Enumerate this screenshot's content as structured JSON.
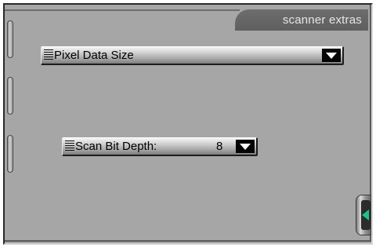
{
  "panel": {
    "title": "scanner extras"
  },
  "side_tabs": [
    {
      "name": "side-tab-1"
    },
    {
      "name": "side-tab-2"
    },
    {
      "name": "side-tab-3"
    }
  ],
  "pixel_data_size": {
    "label": "Pixel Data Size",
    "icon": "grip-lines-icon",
    "arrow_icon": "triangle-down-icon"
  },
  "scan_bit_depth": {
    "label": "Scan Bit Depth:",
    "value": "8",
    "icon": "grip-lines-icon",
    "arrow_icon": "triangle-down-icon"
  },
  "drawer_handle": {
    "icon": "triangle-left-icon",
    "arrow_color": "#1fbf8f"
  },
  "colors": {
    "panel_background": "#a6a6a6",
    "title_tab": "#676767",
    "title_text": "#e6e6e6"
  }
}
